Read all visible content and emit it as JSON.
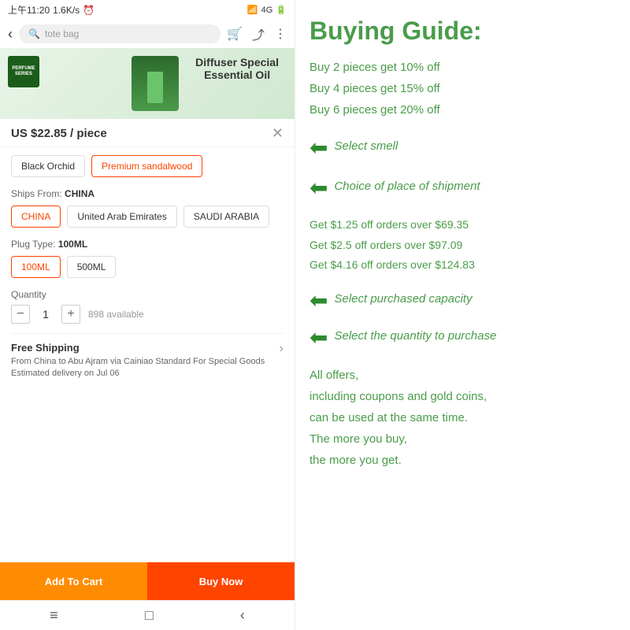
{
  "statusBar": {
    "time": "上午11:20",
    "speed": "1.6K/s",
    "signal": "4G"
  },
  "searchBar": {
    "placeholder": "tote bag",
    "backIcon": "‹",
    "cartIcon": "🛒",
    "shareIcon": "⤴",
    "moreIcon": "⋮"
  },
  "product": {
    "heroTitle1": "Diffuser Special",
    "heroTitle2": "Essential Oil",
    "price": "US $22.85 / piece",
    "seriesLabel": "PERFUME SERIES"
  },
  "smellOptions": {
    "label": "",
    "options": [
      "Black Orchid",
      "Premium sandalwood"
    ]
  },
  "shipsFrom": {
    "label": "Ships From:",
    "origin": "CHINA",
    "locations": [
      "CHINA",
      "United Arab Emirates",
      "SAUDI ARABIA"
    ]
  },
  "plugType": {
    "label": "Plug Type:",
    "selected": "100ML",
    "options": [
      "100ML",
      "500ML"
    ]
  },
  "quantity": {
    "label": "Quantity",
    "value": "1",
    "available": "898 available",
    "minusIcon": "−",
    "plusIcon": "+"
  },
  "shipping": {
    "title": "Free Shipping",
    "detail": "From China to Abu Ajram via Cainiao Standard For Special Goods",
    "delivery": "Estimated delivery on Jul 06"
  },
  "buttons": {
    "addToCart": "Add To Cart",
    "buyNow": "Buy Now"
  },
  "bottomNav": {
    "home": "≡",
    "square": "□",
    "back": "‹"
  },
  "guide": {
    "title": "Buying Guide:",
    "discounts": [
      "Buy 2 pieces get 10% off",
      "Buy 4 pieces get 15% off",
      "Buy 6 pieces get 20% off"
    ],
    "smellLabel": "Select smell",
    "shipmentLabel": "Choice of place of shipment",
    "orders": [
      "Get $1.25 off orders over $69.35",
      "Get $2.5 off orders over $97.09",
      "Get $4.16 off orders over $124.83"
    ],
    "capacityLabel": "Select purchased capacity",
    "quantityLabel": "Select the quantity to purchase",
    "bottomText": "All offers,\nincluding coupons and gold coins,\ncan be used at the same time.\nThe more you buy,\nthe more you get."
  },
  "colors": {
    "green": "#4a9c4a",
    "orange": "#ff8c00",
    "red": "#ff4400",
    "selectedBorder": "#ff4400"
  }
}
